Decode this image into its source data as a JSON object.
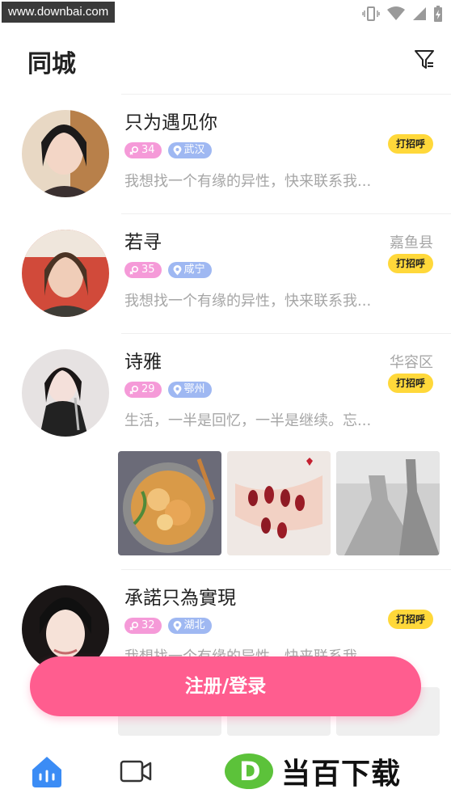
{
  "status_bar": {
    "watermark": "www.downbai.com"
  },
  "header": {
    "title": "同城"
  },
  "feed": [
    {
      "name": "只为遇见你",
      "age": "34",
      "location": "武汉",
      "distance": "",
      "bio": "我想找一个有缘的异性，快来联系我...",
      "greet_label": "打招呼"
    },
    {
      "name": "若寻",
      "age": "35",
      "location": "咸宁",
      "distance": "嘉鱼县",
      "bio": "我想找一个有缘的异性，快来联系我...",
      "greet_label": "打招呼"
    },
    {
      "name": "诗雅",
      "age": "29",
      "location": "鄂州",
      "distance": "华容区",
      "bio": "生活，一半是回忆，一半是继续。忘...",
      "greet_label": "打招呼"
    },
    {
      "name": "承諾只為實現",
      "age": "32",
      "location": "湖北",
      "distance": "",
      "bio": "我想找一个有缘的异性，快来联系我...",
      "greet_label": "打招呼"
    }
  ],
  "register_button": "注册/登录",
  "watermark_logo": "当百下载",
  "colors": {
    "accent_pink": "#ff5d8f",
    "greet_yellow": "#ffd83a",
    "age_tag": "#f59ad8",
    "location_tag": "#9fb8f2",
    "nav_active": "#3b8cf5"
  }
}
